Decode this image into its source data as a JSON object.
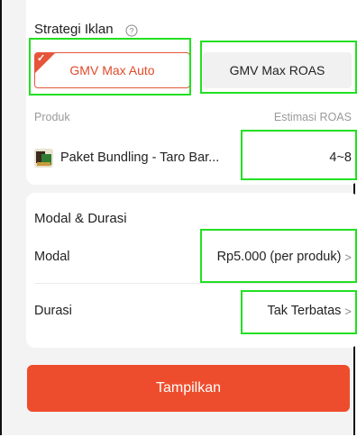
{
  "strategy": {
    "title": "Strategi Iklan",
    "options": [
      "GMV Max Auto",
      "GMV Max ROAS"
    ],
    "selected": "GMV Max Auto"
  },
  "product_table": {
    "headers": {
      "product": "Produk",
      "roas": "Estimasi ROAS"
    },
    "rows": [
      {
        "name": "Paket Bundling - Taro Bar...",
        "roas": "4~8"
      }
    ]
  },
  "budget_section": {
    "title": "Modal & Durasi",
    "budget_label": "Modal",
    "budget_value": "Rp5.000 (per produk)",
    "duration_label": "Durasi",
    "duration_value": "Tak Terbatas"
  },
  "cta": {
    "label": "Tampilkan"
  },
  "colors": {
    "accent": "#ee4d2d",
    "highlight": "#22e022"
  },
  "icons": [
    "help-icon",
    "check-icon",
    "chevron-right-icon",
    "product-thumbnail"
  ]
}
